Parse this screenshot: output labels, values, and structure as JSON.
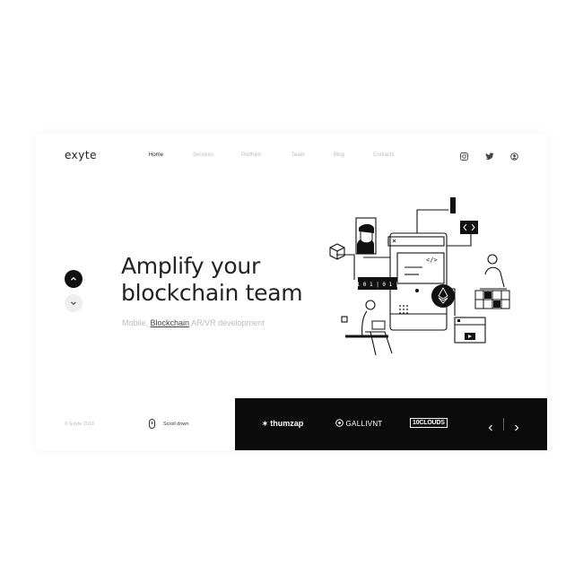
{
  "brand": {
    "logo": "exyte"
  },
  "nav": {
    "items": [
      {
        "label": "Home",
        "active": true
      },
      {
        "label": "Services",
        "active": false
      },
      {
        "label": "Portfolio",
        "active": false
      },
      {
        "label": "Team",
        "active": false
      },
      {
        "label": "Blog",
        "active": false
      },
      {
        "label": "Contacts",
        "active": false
      }
    ]
  },
  "social": [
    "instagram-icon",
    "twitter-icon",
    "github-icon"
  ],
  "hero": {
    "title_line1": "Amplify your",
    "title_line2": "blockchain team",
    "sub_prefix": "Mobile,",
    "sub_highlight": "Blockchain",
    "sub_suffix": "AR/VR development"
  },
  "illustration": {
    "chip_text": "1 0 1 | 0 1 |"
  },
  "footer": {
    "copyright": "© Exyte 2018",
    "scroll_label": "Scroll down"
  },
  "clients": {
    "items": [
      "thumzap",
      "GALLIVNT",
      "10CLOUDS"
    ],
    "prev_icon": "chevron-left-icon",
    "next_icon": "chevron-right-icon"
  },
  "colors": {
    "dark": "#0b0b0b",
    "muted": "#bbbbbb",
    "text": "#222222"
  }
}
